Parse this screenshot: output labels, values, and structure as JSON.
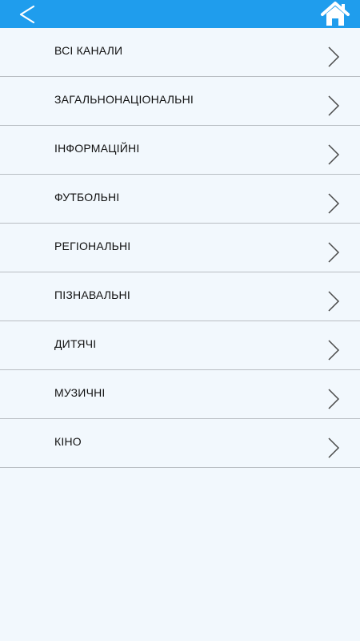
{
  "header": {
    "back_icon": "chevron-left-icon",
    "home_icon": "home-icon",
    "bar_color": "#1f9ded"
  },
  "categories": [
    {
      "label": "ВСІ КАНАЛИ"
    },
    {
      "label": "ЗАГАЛЬНОНАЦІОНАЛЬНІ"
    },
    {
      "label": "ІНФОРМАЦІЙНІ"
    },
    {
      "label": "ФУТБОЛЬНІ"
    },
    {
      "label": "РЕГІОНАЛЬНІ"
    },
    {
      "label": "ПІЗНАВАЛЬНІ"
    },
    {
      "label": "ДИТЯЧІ"
    },
    {
      "label": "МУЗИЧНІ"
    },
    {
      "label": "КІНО"
    }
  ]
}
